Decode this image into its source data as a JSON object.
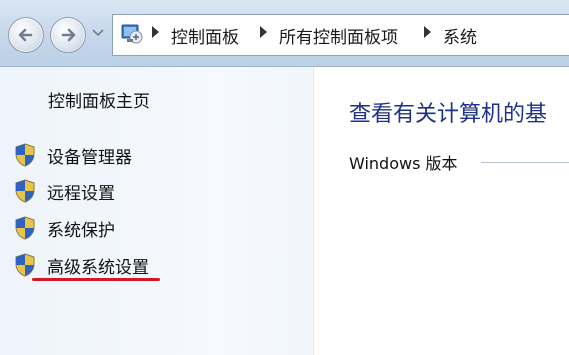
{
  "navigation": {
    "back_icon": "back-arrow-icon",
    "forward_icon": "forward-arrow-icon",
    "recent_icon": "chevron-down-icon"
  },
  "address_bar": {
    "icon": "control-panel-icon",
    "breadcrumbs": [
      "控制面板",
      "所有控制面板项",
      "系统"
    ]
  },
  "left_pane": {
    "home_link": "控制面板主页",
    "tasks": [
      {
        "label": "设备管理器",
        "icon": "uac-shield-icon"
      },
      {
        "label": "远程设置",
        "icon": "uac-shield-icon"
      },
      {
        "label": "系统保护",
        "icon": "uac-shield-icon"
      },
      {
        "label": "高级系统设置",
        "icon": "uac-shield-icon",
        "annotated": true
      }
    ],
    "annotation_color": "#d31826"
  },
  "main": {
    "title": "查看有关计算机的基",
    "section_heading": "Windows 版本",
    "title_color": "#1e3287"
  }
}
